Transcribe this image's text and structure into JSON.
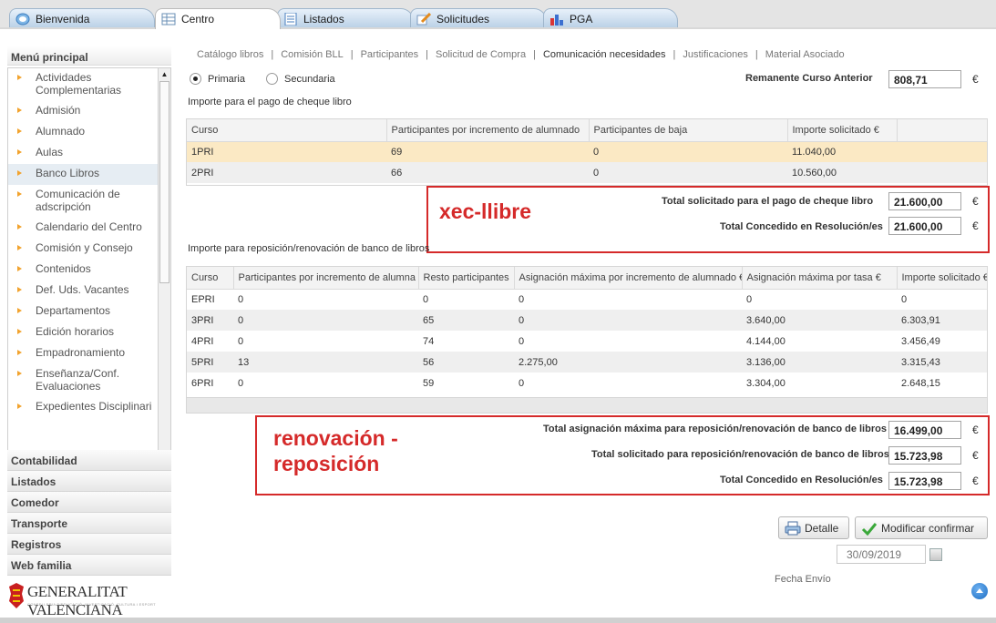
{
  "tabs": [
    {
      "label": "Bienvenida",
      "icon": "globe-icon"
    },
    {
      "label": "Centro",
      "icon": "grid-icon"
    },
    {
      "label": "Listados",
      "icon": "list-icon"
    },
    {
      "label": "Solicitudes",
      "icon": "pencil-icon"
    },
    {
      "label": "PGA",
      "icon": "bar-chart-icon"
    }
  ],
  "sidebar": {
    "title": "Menú principal",
    "items": [
      {
        "label": "Actividades Complementarias"
      },
      {
        "label": "Admisión"
      },
      {
        "label": "Alumnado"
      },
      {
        "label": "Aulas"
      },
      {
        "label": "Banco Libros"
      },
      {
        "label": "Comunicación de adscripción"
      },
      {
        "label": "Calendario del Centro"
      },
      {
        "label": "Comisión y Consejo"
      },
      {
        "label": "Contenidos"
      },
      {
        "label": "Def. Uds. Vacantes"
      },
      {
        "label": "Departamentos"
      },
      {
        "label": "Edición horarios"
      },
      {
        "label": "Empadronamiento"
      },
      {
        "label": "Enseñanza/Conf. Evaluaciones"
      },
      {
        "label": "Expedientes Disciplinari"
      }
    ],
    "sections": [
      "Contabilidad",
      "Listados",
      "Comedor",
      "Transporte",
      "Registros",
      "Web familia"
    ],
    "logo_text": "GENERALITAT VALENCIANA",
    "logo_sub": "CONSELLERIA D'EDUCACIÓ, INVESTIGACIÓ, CULTURA I ESPORT"
  },
  "subnav": [
    "Catálogo libros",
    "Comisión BLL",
    "Participantes",
    "Solicitud de Compra",
    "Comunicación necesidades",
    "Justificaciones",
    "Material Asociado"
  ],
  "radios": {
    "primaria": "Primaria",
    "secundaria": "Secundaria"
  },
  "remanente": {
    "label": "Remanente Curso Anterior",
    "value": "808,71",
    "currency": "€"
  },
  "cheque": {
    "title": "Importe para el pago de cheque libro",
    "headers": [
      "Curso",
      "Participantes por incremento de alumnado",
      "Participantes de baja",
      "Importe solicitado €"
    ],
    "rows": [
      [
        "1PRI",
        "69",
        "0",
        "11.040,00"
      ],
      [
        "2PRI",
        "66",
        "0",
        "10.560,00"
      ]
    ],
    "total_solicitado_label": "Total solicitado para el pago de cheque libro",
    "total_solicitado": "21.600,00",
    "total_concedido_label": "Total Concedido en Resolución/es",
    "total_concedido": "21.600,00"
  },
  "annotation_1": "xec-llibre",
  "reposicion": {
    "title": "Importe para reposición/renovación de banco de libros",
    "headers": [
      "Curso",
      "Participantes por incremento de alumna",
      "Resto participantes",
      "Asignación máxima por incremento de alumnado €",
      "Asignación máxima por tasa €",
      "Importe solicitado €"
    ],
    "rows": [
      [
        "EPRI",
        "0",
        "0",
        "0",
        "0",
        "0"
      ],
      [
        "3PRI",
        "0",
        "65",
        "0",
        "3.640,00",
        "6.303,91"
      ],
      [
        "4PRI",
        "0",
        "74",
        "0",
        "4.144,00",
        "3.456,49"
      ],
      [
        "5PRI",
        "13",
        "56",
        "2.275,00",
        "3.136,00",
        "3.315,43"
      ],
      [
        "6PRI",
        "0",
        "59",
        "0",
        "3.304,00",
        "2.648,15"
      ]
    ],
    "total_max_label": "Total asignación máxima para reposición/renovación de banco de libros",
    "total_max": "16.499,00",
    "total_solicitado_label": "Total solicitado para reposición/renovación de banco de libros",
    "total_solicitado": "15.723,98",
    "total_concedido_label": "Total Concedido en Resolución/es",
    "total_concedido": "15.723,98"
  },
  "annotation_2_line1": "renovación -",
  "annotation_2_line2": "reposición",
  "buttons": {
    "detalle": "Detalle",
    "modificar": "Modificar confirmar"
  },
  "fecha": {
    "label": "Fecha Envío",
    "value": "30/09/2019"
  },
  "currency": "€",
  "colors": {
    "accent_red": "#d52a2a",
    "highlight_row": "#fbe9c4",
    "tab_blue": "#b9d0e6"
  }
}
